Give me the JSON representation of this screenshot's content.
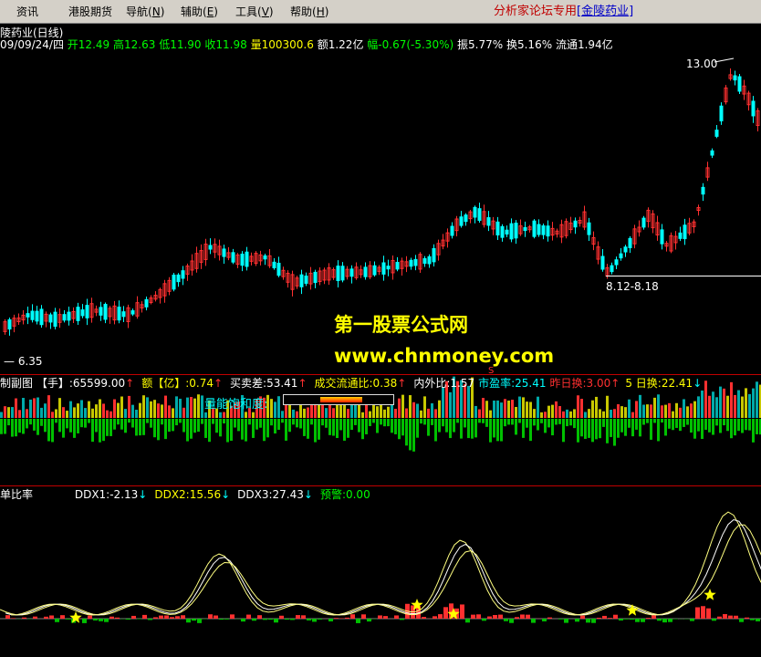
{
  "menu": {
    "items": [
      "资讯",
      "港股期货",
      "导航",
      "辅助",
      "工具",
      "帮助"
    ],
    "hotkeys": [
      "",
      "",
      "N",
      "E",
      "V",
      "H"
    ],
    "brand_text": "分析家论坛专用",
    "brand_link": "[金陵药业]"
  },
  "stock": {
    "title": "陵药业(日线)",
    "date": "09/09/24/四",
    "open_label": "开",
    "open": "12.49",
    "high_label": "高",
    "high": "12.63",
    "low_label": "低",
    "low": "11.90",
    "close_label": "收",
    "close": "11.98",
    "vol_label": "量",
    "vol": "100300.6",
    "amt_label": "额",
    "amt": "1.22亿",
    "chg_label": "幅",
    "chg": "-0.67(-5.30%)",
    "amp_label": "振",
    "amp": "5.77%",
    "turn_label": "换",
    "turn": "5.16%",
    "float_label": "流通",
    "float": "1.94亿"
  },
  "price_labels": {
    "high_mark": "13.00",
    "range_mark": "8.12-8.18",
    "low_mark": "6.35"
  },
  "watermark": {
    "cn": "第一股票公式网",
    "url": "www.chnmoney.com"
  },
  "sub1": {
    "title": "制副图",
    "items": [
      {
        "label": "【手】:65599.00",
        "color": "#ffffff",
        "arrow": "↑",
        "arrow_color": "#ff3030"
      },
      {
        "label": "额【亿】:0.74",
        "color": "#ffff00",
        "arrow": "↑",
        "arrow_color": "#ff3030"
      },
      {
        "label": "买卖差:53.41",
        "color": "#ffffff",
        "arrow": "↑",
        "arrow_color": "#ff3030"
      },
      {
        "label": "成交流通比:0.38",
        "color": "#ffff00",
        "arrow": "↑",
        "arrow_color": "#ff3030"
      },
      {
        "label": "内外比:1.57",
        "color": "#ffffff",
        "arrow": "",
        "arrow_color": "#ff3030"
      },
      {
        "label": "市盈率:25.41",
        "color": "#00ffff",
        "arrow": "",
        "arrow_color": "#ff3030"
      },
      {
        "label": "昨日换:3.00",
        "color": "#ff3030",
        "arrow": "↑",
        "arrow_color": "#ff3030"
      },
      {
        "label": "5 日换:22.41",
        "color": "#ffff00",
        "arrow": "↓",
        "arrow_color": "#00ffff"
      }
    ],
    "saturation_label": "量能饱和度:",
    "s_marker": "S"
  },
  "sub2": {
    "title": "单比率",
    "items": [
      {
        "label": "DDX1:-2.13",
        "color": "#ffffff",
        "arrow": "↓",
        "arrow_color": "#00ffff"
      },
      {
        "label": "DDX2:15.56",
        "color": "#ffff00",
        "arrow": "↓",
        "arrow_color": "#00ffff"
      },
      {
        "label": "DDX3:27.43",
        "color": "#ffffff",
        "arrow": "↓",
        "arrow_color": "#00ffff"
      },
      {
        "label": "预警:0.00",
        "color": "#00ff00",
        "arrow": "",
        "arrow_color": "#00ffff"
      }
    ]
  },
  "colors": {
    "up": "#ff3030",
    "down": "#00ffff",
    "vol_yellow": "#c8c800",
    "vol_cyan": "#00aaaa",
    "vol_green": "#00c000",
    "grid": "#c00000",
    "ddx_line": "#ffff80"
  }
}
